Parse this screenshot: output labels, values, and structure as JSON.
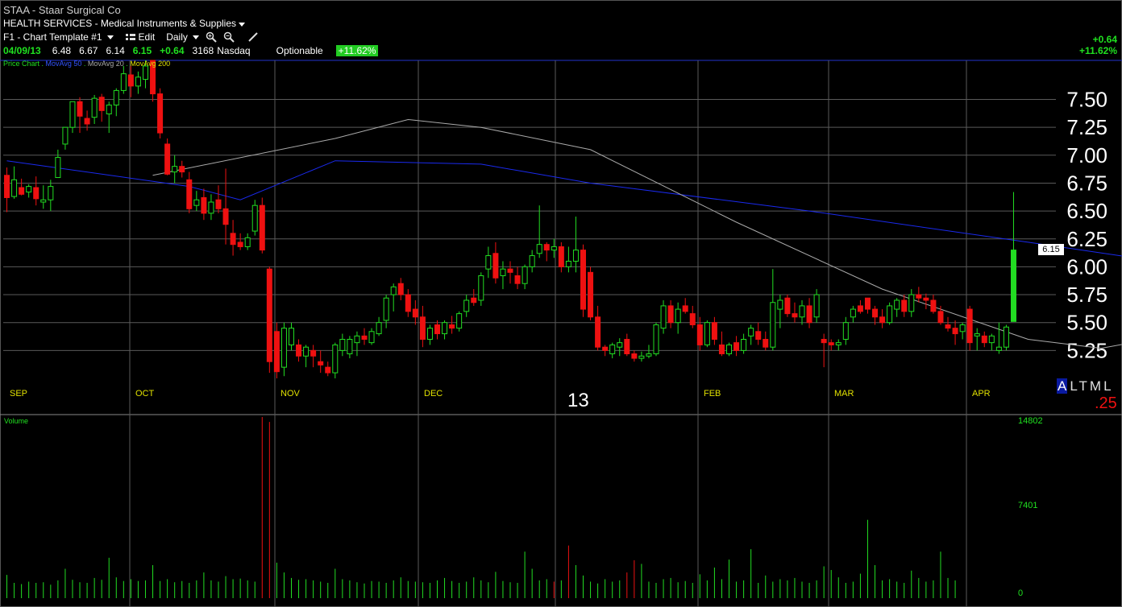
{
  "header": {
    "symbol": "STAA",
    "separator": " - ",
    "company": "Staar Surgical Co",
    "sector": "HEALTH SERVICES - Medical Instruments & Supplies",
    "template": "F1 - Chart Template #1",
    "edit_label": "Edit",
    "period": "Daily"
  },
  "quote": {
    "date": "04/09/13",
    "open": "6.48",
    "high": "6.67",
    "low": "6.14",
    "close": "6.15",
    "change": "+0.64",
    "volume": "3168",
    "exchange": "Nasdaq",
    "optionable": "Optionable",
    "pct": "+11.62%"
  },
  "right_change": {
    "change": "+0.64",
    "pct": "+11.62%"
  },
  "legend": {
    "price": "Price Chart",
    "ma50": "MovAvg 50",
    "ma20": "MovAvg 20",
    "ma200": "MovAvg 200"
  },
  "period_buttons": {
    "selected": "A",
    "others": "LTML"
  },
  "increment": ".25",
  "year_label": "13",
  "last_price_tag": "6.15",
  "volume_panel": {
    "label": "Volume",
    "ticks": [
      "14802",
      "7401",
      "0"
    ],
    "ymax": 14802
  },
  "colors": {
    "up": "#22dd22",
    "down": "#ee1111",
    "ma20": "#aaaaaa",
    "ma50": "#1a2aee",
    "ma200": "#e0e000",
    "grid": "#5a5a5a"
  },
  "chart_data": {
    "type": "candlestick",
    "ylim": [
      5.0,
      7.85
    ],
    "y_ticks": [
      "7.50",
      "7.25",
      "7.00",
      "6.75",
      "6.50",
      "6.25",
      "6.00",
      "5.75",
      "5.50",
      "5.25"
    ],
    "months": [
      "SEP",
      "OCT",
      "NOV",
      "DEC",
      "FEB",
      "MAR",
      "APR"
    ],
    "ma50": [
      [
        0,
        6.95
      ],
      [
        25,
        6.72
      ],
      [
        32,
        6.6
      ],
      [
        45,
        6.95
      ],
      [
        65,
        6.92
      ],
      [
        80,
        6.75
      ],
      [
        110,
        6.5
      ],
      [
        140,
        6.22
      ],
      [
        165,
        5.98
      ],
      [
        200,
        5.72
      ],
      [
        220,
        5.65
      ],
      [
        260,
        5.6
      ],
      [
        300,
        5.58
      ],
      [
        330,
        5.55
      ],
      [
        360,
        5.47
      ],
      [
        375,
        5.5
      ]
    ],
    "ma20": [
      [
        20,
        6.82
      ],
      [
        45,
        7.15
      ],
      [
        55,
        7.32
      ],
      [
        65,
        7.25
      ],
      [
        80,
        7.05
      ],
      [
        100,
        6.4
      ],
      [
        120,
        5.8
      ],
      [
        140,
        5.35
      ],
      [
        150,
        5.27
      ],
      [
        165,
        5.45
      ],
      [
        180,
        5.55
      ],
      [
        200,
        5.9
      ],
      [
        220,
        5.97
      ],
      [
        240,
        5.75
      ],
      [
        260,
        5.6
      ],
      [
        280,
        5.48
      ],
      [
        300,
        5.45
      ],
      [
        320,
        5.52
      ],
      [
        340,
        5.58
      ],
      [
        360,
        5.55
      ],
      [
        375,
        5.58
      ]
    ],
    "ma200": [
      [
        195,
        7.85
      ],
      [
        210,
        7.7
      ],
      [
        240,
        7.35
      ],
      [
        270,
        7.05
      ],
      [
        300,
        6.75
      ],
      [
        330,
        6.5
      ],
      [
        350,
        6.35
      ],
      [
        373,
        6.2
      ]
    ],
    "candles": [
      [
        6.82,
        6.89,
        6.49,
        6.62
      ],
      [
        6.63,
        6.9,
        6.61,
        6.78
      ],
      [
        6.71,
        6.79,
        6.64,
        6.65
      ],
      [
        6.67,
        6.74,
        6.62,
        6.72
      ],
      [
        6.71,
        6.81,
        6.55,
        6.61
      ],
      [
        6.58,
        6.73,
        6.52,
        6.6
      ],
      [
        6.6,
        6.78,
        6.5,
        6.72
      ],
      [
        6.8,
        7.05,
        6.8,
        6.98
      ],
      [
        7.1,
        7.25,
        7.05,
        7.25
      ],
      [
        7.25,
        7.48,
        7.2,
        7.48
      ],
      [
        7.48,
        7.52,
        7.2,
        7.35
      ],
      [
        7.33,
        7.4,
        7.22,
        7.28
      ],
      [
        7.34,
        7.54,
        7.28,
        7.51
      ],
      [
        7.52,
        7.55,
        7.3,
        7.4
      ],
      [
        7.37,
        7.48,
        7.2,
        7.45
      ],
      [
        7.45,
        7.6,
        7.35,
        7.58
      ],
      [
        7.58,
        7.8,
        7.55,
        7.73
      ],
      [
        7.72,
        7.8,
        7.52,
        7.62
      ],
      [
        7.62,
        7.75,
        7.55,
        7.7
      ],
      [
        7.68,
        7.85,
        7.6,
        7.8
      ],
      [
        7.85,
        7.85,
        7.48,
        7.55
      ],
      [
        7.55,
        7.6,
        7.15,
        7.2
      ],
      [
        7.1,
        7.15,
        6.82,
        6.83
      ],
      [
        6.85,
        7.0,
        6.75,
        6.9
      ],
      [
        6.9,
        6.95,
        6.8,
        6.85
      ],
      [
        6.78,
        6.85,
        6.48,
        6.52
      ],
      [
        6.55,
        6.68,
        6.5,
        6.6
      ],
      [
        6.62,
        6.7,
        6.42,
        6.48
      ],
      [
        6.48,
        6.65,
        6.42,
        6.58
      ],
      [
        6.6,
        6.73,
        6.48,
        6.52
      ],
      [
        6.52,
        6.88,
        6.2,
        6.38
      ],
      [
        6.3,
        6.42,
        6.1,
        6.2
      ],
      [
        6.22,
        6.3,
        6.15,
        6.18
      ],
      [
        6.18,
        6.3,
        6.15,
        6.26
      ],
      [
        6.32,
        6.6,
        6.28,
        6.55
      ],
      [
        6.55,
        6.62,
        6.12,
        6.15
      ],
      [
        5.98,
        6.0,
        5.05,
        5.15
      ],
      [
        5.42,
        5.5,
        5.0,
        5.06
      ],
      [
        5.1,
        5.5,
        5.02,
        5.45
      ],
      [
        5.3,
        5.5,
        5.25,
        5.45
      ],
      [
        5.3,
        5.35,
        5.15,
        5.2
      ],
      [
        5.2,
        5.3,
        5.1,
        5.28
      ],
      [
        5.25,
        5.3,
        5.1,
        5.2
      ],
      [
        5.15,
        5.25,
        5.05,
        5.12
      ],
      [
        5.1,
        5.15,
        5.02,
        5.05
      ],
      [
        5.05,
        5.32,
        5.0,
        5.3
      ],
      [
        5.25,
        5.4,
        5.2,
        5.35
      ],
      [
        5.22,
        5.38,
        5.18,
        5.35
      ],
      [
        5.32,
        5.42,
        5.2,
        5.38
      ],
      [
        5.38,
        5.45,
        5.3,
        5.35
      ],
      [
        5.32,
        5.45,
        5.3,
        5.42
      ],
      [
        5.4,
        5.55,
        5.38,
        5.5
      ],
      [
        5.52,
        5.75,
        5.45,
        5.72
      ],
      [
        5.75,
        5.85,
        5.6,
        5.82
      ],
      [
        5.85,
        5.9,
        5.7,
        5.75
      ],
      [
        5.75,
        5.8,
        5.55,
        5.6
      ],
      [
        5.62,
        5.7,
        5.48,
        5.55
      ],
      [
        5.55,
        5.65,
        5.28,
        5.35
      ],
      [
        5.35,
        5.48,
        5.3,
        5.45
      ],
      [
        5.48,
        5.52,
        5.35,
        5.4
      ],
      [
        5.4,
        5.52,
        5.35,
        5.5
      ],
      [
        5.48,
        5.56,
        5.4,
        5.45
      ],
      [
        5.45,
        5.6,
        5.42,
        5.58
      ],
      [
        5.6,
        5.75,
        5.55,
        5.7
      ],
      [
        5.72,
        5.8,
        5.65,
        5.68
      ],
      [
        5.7,
        5.95,
        5.65,
        5.92
      ],
      [
        5.98,
        6.18,
        5.9,
        6.1
      ],
      [
        6.12,
        6.22,
        5.85,
        5.9
      ],
      [
        5.92,
        6.05,
        5.8,
        5.98
      ],
      [
        5.98,
        6.05,
        5.85,
        5.95
      ],
      [
        5.92,
        6.0,
        5.8,
        5.85
      ],
      [
        5.85,
        6.02,
        5.8,
        6.0
      ],
      [
        6.0,
        6.15,
        5.95,
        6.1
      ],
      [
        6.12,
        6.55,
        6.08,
        6.2
      ],
      [
        6.2,
        6.22,
        6.05,
        6.15
      ],
      [
        6.15,
        6.25,
        6.08,
        6.18
      ],
      [
        6.18,
        6.22,
        5.95,
        6.0
      ],
      [
        6.0,
        6.18,
        5.95,
        6.05
      ],
      [
        6.05,
        6.45,
        5.95,
        6.15
      ],
      [
        6.15,
        6.2,
        5.55,
        5.62
      ],
      [
        5.95,
        6.0,
        5.52,
        5.55
      ],
      [
        5.55,
        5.65,
        5.25,
        5.28
      ],
      [
        5.28,
        5.3,
        5.2,
        5.25
      ],
      [
        5.22,
        5.32,
        5.18,
        5.3
      ],
      [
        5.28,
        5.36,
        5.2,
        5.32
      ],
      [
        5.35,
        5.4,
        5.2,
        5.22
      ],
      [
        5.22,
        5.25,
        5.15,
        5.18
      ],
      [
        5.18,
        5.24,
        5.15,
        5.2
      ],
      [
        5.2,
        5.3,
        5.18,
        5.22
      ],
      [
        5.22,
        5.5,
        5.2,
        5.48
      ],
      [
        5.45,
        5.7,
        5.4,
        5.65
      ],
      [
        5.65,
        5.7,
        5.45,
        5.5
      ],
      [
        5.5,
        5.68,
        5.4,
        5.62
      ],
      [
        5.65,
        5.72,
        5.58,
        5.6
      ],
      [
        5.58,
        5.65,
        5.45,
        5.48
      ],
      [
        5.48,
        5.55,
        5.25,
        5.3
      ],
      [
        5.3,
        5.52,
        5.28,
        5.5
      ],
      [
        5.5,
        5.55,
        5.3,
        5.35
      ],
      [
        5.3,
        5.42,
        5.2,
        5.22
      ],
      [
        5.22,
        5.32,
        5.2,
        5.3
      ],
      [
        5.32,
        5.38,
        5.2,
        5.25
      ],
      [
        5.25,
        5.4,
        5.22,
        5.35
      ],
      [
        5.38,
        5.48,
        5.3,
        5.45
      ],
      [
        5.42,
        5.5,
        5.3,
        5.35
      ],
      [
        5.35,
        5.42,
        5.25,
        5.28
      ],
      [
        5.28,
        5.98,
        5.25,
        5.68
      ],
      [
        5.62,
        5.75,
        5.45,
        5.7
      ],
      [
        5.72,
        5.75,
        5.55,
        5.58
      ],
      [
        5.58,
        5.68,
        5.5,
        5.55
      ],
      [
        5.55,
        5.7,
        5.48,
        5.65
      ],
      [
        5.65,
        5.72,
        5.45,
        5.5
      ],
      [
        5.55,
        5.8,
        5.5,
        5.75
      ],
      [
        5.35,
        5.4,
        5.1,
        5.32
      ],
      [
        5.32,
        5.35,
        5.25,
        5.3
      ],
      [
        5.3,
        5.35,
        5.25,
        5.32
      ],
      [
        5.35,
        5.55,
        5.3,
        5.5
      ],
      [
        5.55,
        5.65,
        5.5,
        5.62
      ],
      [
        5.65,
        5.7,
        5.58,
        5.6
      ],
      [
        5.72,
        5.72,
        5.58,
        5.62
      ],
      [
        5.62,
        5.65,
        5.48,
        5.55
      ],
      [
        5.55,
        5.62,
        5.45,
        5.5
      ],
      [
        5.5,
        5.68,
        5.48,
        5.65
      ],
      [
        5.62,
        5.72,
        5.55,
        5.7
      ],
      [
        5.7,
        5.75,
        5.55,
        5.6
      ],
      [
        5.6,
        5.8,
        5.55,
        5.75
      ],
      [
        5.75,
        5.82,
        5.68,
        5.72
      ],
      [
        5.72,
        5.76,
        5.62,
        5.7
      ],
      [
        5.7,
        5.75,
        5.58,
        5.6
      ],
      [
        5.6,
        5.65,
        5.48,
        5.5
      ],
      [
        5.48,
        5.55,
        5.42,
        5.45
      ],
      [
        5.45,
        5.52,
        5.3,
        5.4
      ],
      [
        5.42,
        5.5,
        5.35,
        5.48
      ],
      [
        5.62,
        5.65,
        5.25,
        5.32
      ],
      [
        5.38,
        5.45,
        5.25,
        5.4
      ],
      [
        5.38,
        5.42,
        5.28,
        5.32
      ],
      [
        5.32,
        5.4,
        5.25,
        5.38
      ],
      [
        5.25,
        5.5,
        5.22,
        5.28
      ],
      [
        5.28,
        5.48,
        5.25,
        5.46
      ],
      [
        5.51,
        6.67,
        6.14,
        6.15
      ]
    ],
    "volumes": [
      1900,
      1250,
      1150,
      1350,
      1250,
      1300,
      1100,
      1450,
      2400,
      1500,
      1300,
      1250,
      1650,
      1500,
      3300,
      1700,
      1400,
      1550,
      1400,
      1450,
      2700,
      1400,
      1550,
      1300,
      1400,
      1250,
      1450,
      2100,
      1450,
      1350,
      1800,
      1550,
      1600,
      1450,
      1350,
      14802,
      14400,
      2900,
      2100,
      1650,
      1500,
      1550,
      1450,
      1350,
      1250,
      2400,
      1550,
      1450,
      1300,
      1200,
      1400,
      1350,
      1250,
      1450,
      1700,
      1400,
      1350,
      1300,
      1250,
      1450,
      1650,
      1400,
      1250,
      1350,
      1700,
      1450,
      1300,
      2150,
      1400,
      1300,
      1250,
      3800,
      2400,
      1450,
      1550,
      1350,
      1450,
      4300,
      2700,
      1850,
      1350,
      1200,
      1550,
      1350,
      1450,
      2100,
      3100,
      2800,
      1350,
      1250,
      1550,
      1650,
      1300,
      1400,
      1250,
      1950,
      1450,
      2500,
      1550,
      3150,
      1350,
      1450,
      4000,
      1250,
      1850,
      1350,
      1550,
      1450,
      1650,
      1350,
      1250,
      1450,
      2600,
      2300,
      1700,
      1250,
      1350,
      2000,
      6400,
      2700,
      1450,
      1550,
      1350,
      1250,
      2250,
      1650,
      1350,
      1450,
      3800,
      1650,
      1450
    ]
  }
}
